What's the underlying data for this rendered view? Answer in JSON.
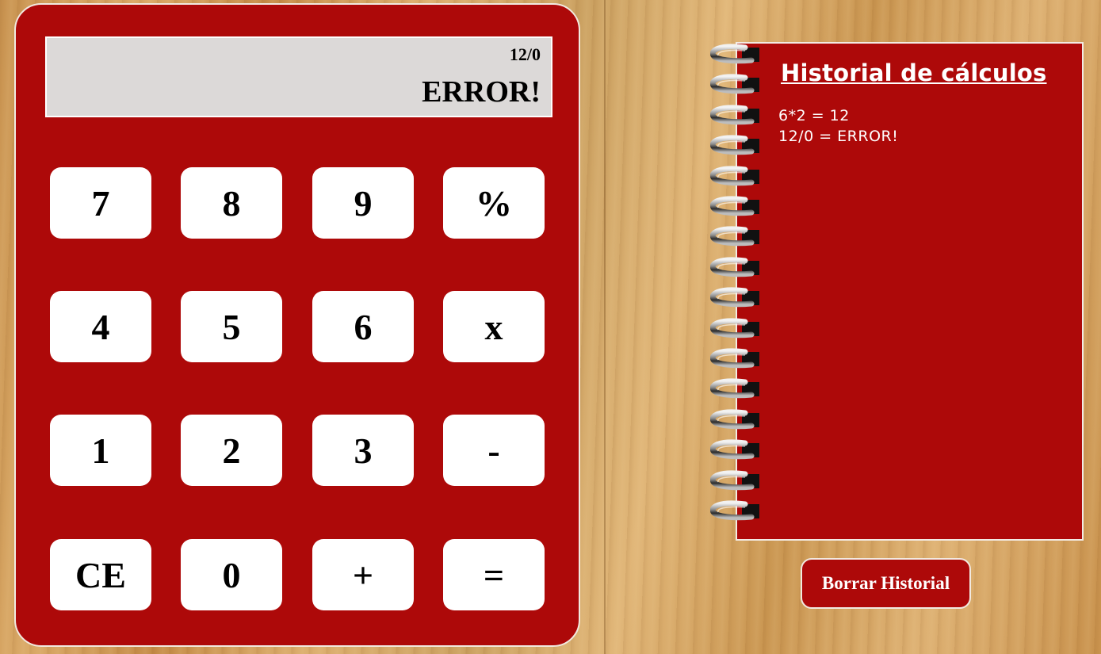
{
  "display": {
    "expression": "12/0",
    "result": "ERROR!"
  },
  "keys": [
    [
      "7",
      "8",
      "9",
      "%"
    ],
    [
      "4",
      "5",
      "6",
      "x"
    ],
    [
      "1",
      "2",
      "3",
      "-"
    ],
    [
      "CE",
      "0",
      "+",
      "="
    ]
  ],
  "history": {
    "title": "Historial de cálculos",
    "entries": [
      "6*2 = 12",
      "12/0 = ERROR!"
    ]
  },
  "clear_history_label": "Borrar Historial",
  "colors": {
    "calculator_red": "#ad0909",
    "display_bg": "#dcd9d8",
    "key_bg": "#ffffff",
    "wood": "#d4a062"
  }
}
